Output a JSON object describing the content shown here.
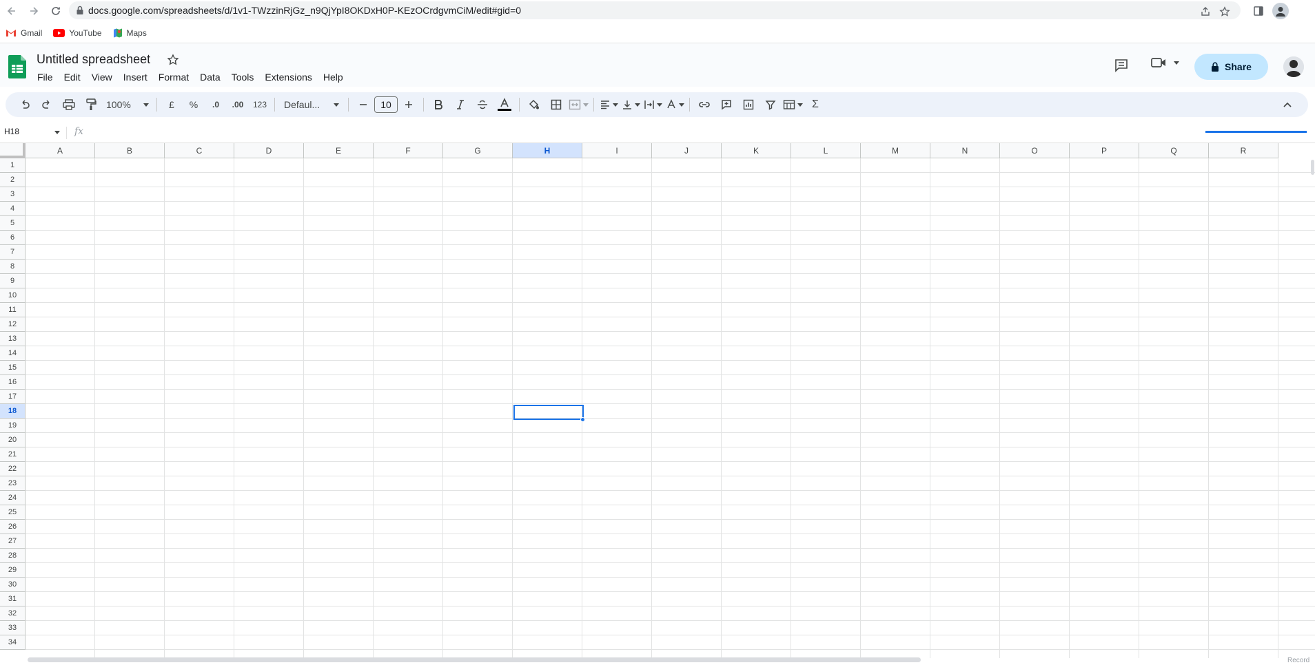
{
  "browser": {
    "url": "docs.google.com/spreadsheets/d/1v1-TWzzinRjGz_n9QjYpI8OKDxH0P-KEzOCrdgvmCiM/edit#gid=0",
    "bookmarks": [
      {
        "label": "Gmail",
        "icon": "gmail-icon"
      },
      {
        "label": "YouTube",
        "icon": "youtube-icon"
      },
      {
        "label": "Maps",
        "icon": "maps-icon"
      }
    ]
  },
  "header": {
    "title": "Untitled spreadsheet",
    "menus": [
      "File",
      "Edit",
      "View",
      "Insert",
      "Format",
      "Data",
      "Tools",
      "Extensions",
      "Help"
    ],
    "share_label": "Share"
  },
  "toolbar": {
    "zoom": "100%",
    "currency": "£",
    "percent": "%",
    "decrease_decimal": ".0",
    "increase_decimal": ".00",
    "number_format": "123",
    "font": "Defaul...",
    "font_size": "10",
    "sum_symbol": "Σ"
  },
  "formula_bar": {
    "cell_ref": "H18",
    "fx": "fx"
  },
  "grid": {
    "columns": [
      "A",
      "B",
      "C",
      "D",
      "E",
      "F",
      "G",
      "H",
      "I",
      "J",
      "K",
      "L",
      "M",
      "N",
      "O",
      "P",
      "Q",
      "R"
    ],
    "rows": [
      "1",
      "2",
      "3",
      "4",
      "5",
      "6",
      "7",
      "8",
      "9",
      "10",
      "11",
      "12",
      "13",
      "14",
      "15",
      "16",
      "17",
      "18",
      "19",
      "20",
      "21",
      "22",
      "23",
      "24",
      "25",
      "26",
      "27",
      "28",
      "29",
      "30",
      "31",
      "32",
      "33",
      "34"
    ],
    "selected_column": "H",
    "selected_row": "18"
  },
  "footer": {
    "record_label": "Record"
  },
  "colors": {
    "accent": "#1a73e8",
    "share_bg": "#c2e7ff",
    "toolbar_bg": "#edf2fa",
    "sheets_green": "#0f9d58"
  }
}
